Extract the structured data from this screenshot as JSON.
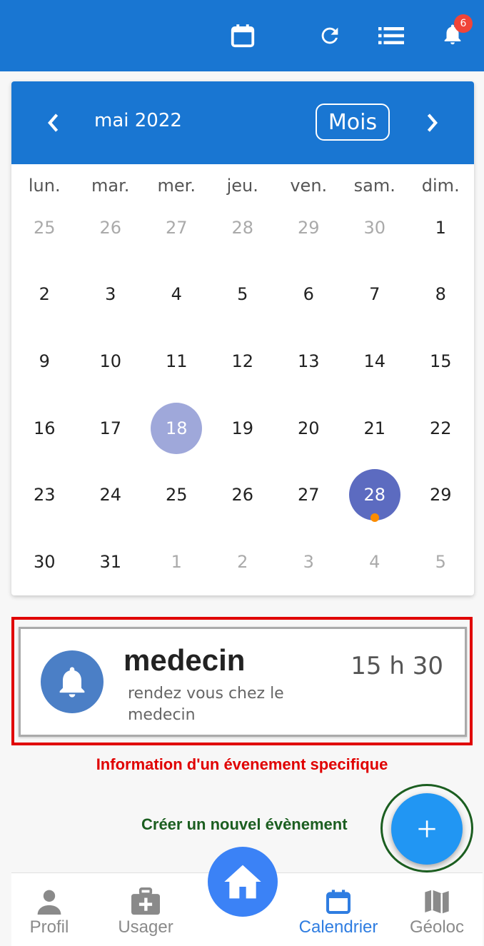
{
  "topbar": {
    "notification_count": "6",
    "icons": [
      "calendar-icon",
      "refresh-icon",
      "list-icon",
      "bell-icon"
    ]
  },
  "calendar": {
    "month_label": "mai 2022",
    "mode_label": "Mois",
    "weekdays": [
      "lun.",
      "mar.",
      "mer.",
      "jeu.",
      "ven.",
      "sam.",
      "dim."
    ],
    "weeks": [
      [
        "25",
        "26",
        "27",
        "28",
        "29",
        "30",
        "1"
      ],
      [
        "2",
        "3",
        "4",
        "5",
        "6",
        "7",
        "8"
      ],
      [
        "9",
        "10",
        "11",
        "12",
        "13",
        "14",
        "15"
      ],
      [
        "16",
        "17",
        "18",
        "19",
        "20",
        "21",
        "22"
      ],
      [
        "23",
        "24",
        "25",
        "26",
        "27",
        "28",
        "29"
      ],
      [
        "30",
        "31",
        "1",
        "2",
        "3",
        "4",
        "5"
      ]
    ],
    "selected_day": "18",
    "today": "28",
    "event_dot_color": "#fb8c00"
  },
  "event": {
    "title": "medecin",
    "description": "rendez vous chez le medecin",
    "time": "15 h 30"
  },
  "annotations": {
    "event_info": "Information d'un évenement specifique",
    "new_event": "Créer un nouvel évènement"
  },
  "fab_label": "+",
  "bottom_nav": {
    "profil": "Profil",
    "usager": "Usager",
    "calendrier": "Calendrier",
    "geoloc": "Géoloc"
  },
  "colors": {
    "primary": "#1976d2",
    "annotation_red": "#e00000",
    "annotation_green": "#1b5e20"
  }
}
